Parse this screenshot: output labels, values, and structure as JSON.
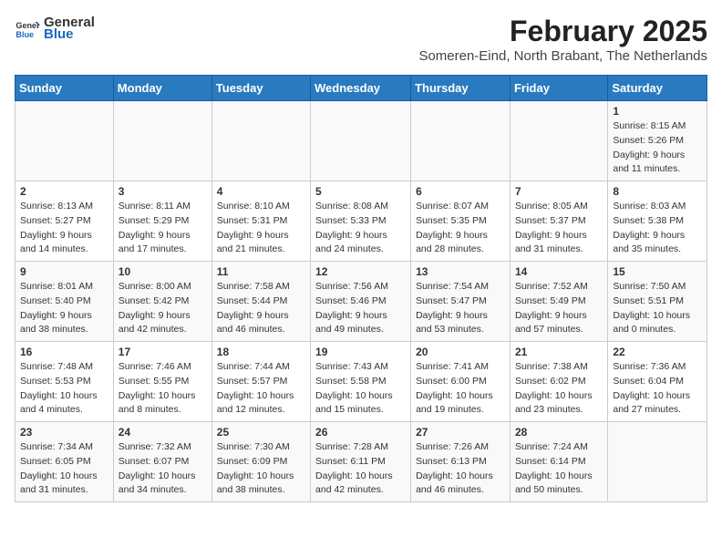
{
  "logo": {
    "line1": "General",
    "line2": "Blue"
  },
  "title": {
    "month_year": "February 2025",
    "location": "Someren-Eind, North Brabant, The Netherlands"
  },
  "days_of_week": [
    "Sunday",
    "Monday",
    "Tuesday",
    "Wednesday",
    "Thursday",
    "Friday",
    "Saturday"
  ],
  "weeks": [
    [
      {
        "day": "",
        "info": ""
      },
      {
        "day": "",
        "info": ""
      },
      {
        "day": "",
        "info": ""
      },
      {
        "day": "",
        "info": ""
      },
      {
        "day": "",
        "info": ""
      },
      {
        "day": "",
        "info": ""
      },
      {
        "day": "1",
        "info": "Sunrise: 8:15 AM\nSunset: 5:26 PM\nDaylight: 9 hours\nand 11 minutes."
      }
    ],
    [
      {
        "day": "2",
        "info": "Sunrise: 8:13 AM\nSunset: 5:27 PM\nDaylight: 9 hours\nand 14 minutes."
      },
      {
        "day": "3",
        "info": "Sunrise: 8:11 AM\nSunset: 5:29 PM\nDaylight: 9 hours\nand 17 minutes."
      },
      {
        "day": "4",
        "info": "Sunrise: 8:10 AM\nSunset: 5:31 PM\nDaylight: 9 hours\nand 21 minutes."
      },
      {
        "day": "5",
        "info": "Sunrise: 8:08 AM\nSunset: 5:33 PM\nDaylight: 9 hours\nand 24 minutes."
      },
      {
        "day": "6",
        "info": "Sunrise: 8:07 AM\nSunset: 5:35 PM\nDaylight: 9 hours\nand 28 minutes."
      },
      {
        "day": "7",
        "info": "Sunrise: 8:05 AM\nSunset: 5:37 PM\nDaylight: 9 hours\nand 31 minutes."
      },
      {
        "day": "8",
        "info": "Sunrise: 8:03 AM\nSunset: 5:38 PM\nDaylight: 9 hours\nand 35 minutes."
      }
    ],
    [
      {
        "day": "9",
        "info": "Sunrise: 8:01 AM\nSunset: 5:40 PM\nDaylight: 9 hours\nand 38 minutes."
      },
      {
        "day": "10",
        "info": "Sunrise: 8:00 AM\nSunset: 5:42 PM\nDaylight: 9 hours\nand 42 minutes."
      },
      {
        "day": "11",
        "info": "Sunrise: 7:58 AM\nSunset: 5:44 PM\nDaylight: 9 hours\nand 46 minutes."
      },
      {
        "day": "12",
        "info": "Sunrise: 7:56 AM\nSunset: 5:46 PM\nDaylight: 9 hours\nand 49 minutes."
      },
      {
        "day": "13",
        "info": "Sunrise: 7:54 AM\nSunset: 5:47 PM\nDaylight: 9 hours\nand 53 minutes."
      },
      {
        "day": "14",
        "info": "Sunrise: 7:52 AM\nSunset: 5:49 PM\nDaylight: 9 hours\nand 57 minutes."
      },
      {
        "day": "15",
        "info": "Sunrise: 7:50 AM\nSunset: 5:51 PM\nDaylight: 10 hours\nand 0 minutes."
      }
    ],
    [
      {
        "day": "16",
        "info": "Sunrise: 7:48 AM\nSunset: 5:53 PM\nDaylight: 10 hours\nand 4 minutes."
      },
      {
        "day": "17",
        "info": "Sunrise: 7:46 AM\nSunset: 5:55 PM\nDaylight: 10 hours\nand 8 minutes."
      },
      {
        "day": "18",
        "info": "Sunrise: 7:44 AM\nSunset: 5:57 PM\nDaylight: 10 hours\nand 12 minutes."
      },
      {
        "day": "19",
        "info": "Sunrise: 7:43 AM\nSunset: 5:58 PM\nDaylight: 10 hours\nand 15 minutes."
      },
      {
        "day": "20",
        "info": "Sunrise: 7:41 AM\nSunset: 6:00 PM\nDaylight: 10 hours\nand 19 minutes."
      },
      {
        "day": "21",
        "info": "Sunrise: 7:38 AM\nSunset: 6:02 PM\nDaylight: 10 hours\nand 23 minutes."
      },
      {
        "day": "22",
        "info": "Sunrise: 7:36 AM\nSunset: 6:04 PM\nDaylight: 10 hours\nand 27 minutes."
      }
    ],
    [
      {
        "day": "23",
        "info": "Sunrise: 7:34 AM\nSunset: 6:05 PM\nDaylight: 10 hours\nand 31 minutes."
      },
      {
        "day": "24",
        "info": "Sunrise: 7:32 AM\nSunset: 6:07 PM\nDaylight: 10 hours\nand 34 minutes."
      },
      {
        "day": "25",
        "info": "Sunrise: 7:30 AM\nSunset: 6:09 PM\nDaylight: 10 hours\nand 38 minutes."
      },
      {
        "day": "26",
        "info": "Sunrise: 7:28 AM\nSunset: 6:11 PM\nDaylight: 10 hours\nand 42 minutes."
      },
      {
        "day": "27",
        "info": "Sunrise: 7:26 AM\nSunset: 6:13 PM\nDaylight: 10 hours\nand 46 minutes."
      },
      {
        "day": "28",
        "info": "Sunrise: 7:24 AM\nSunset: 6:14 PM\nDaylight: 10 hours\nand 50 minutes."
      },
      {
        "day": "",
        "info": ""
      }
    ]
  ]
}
